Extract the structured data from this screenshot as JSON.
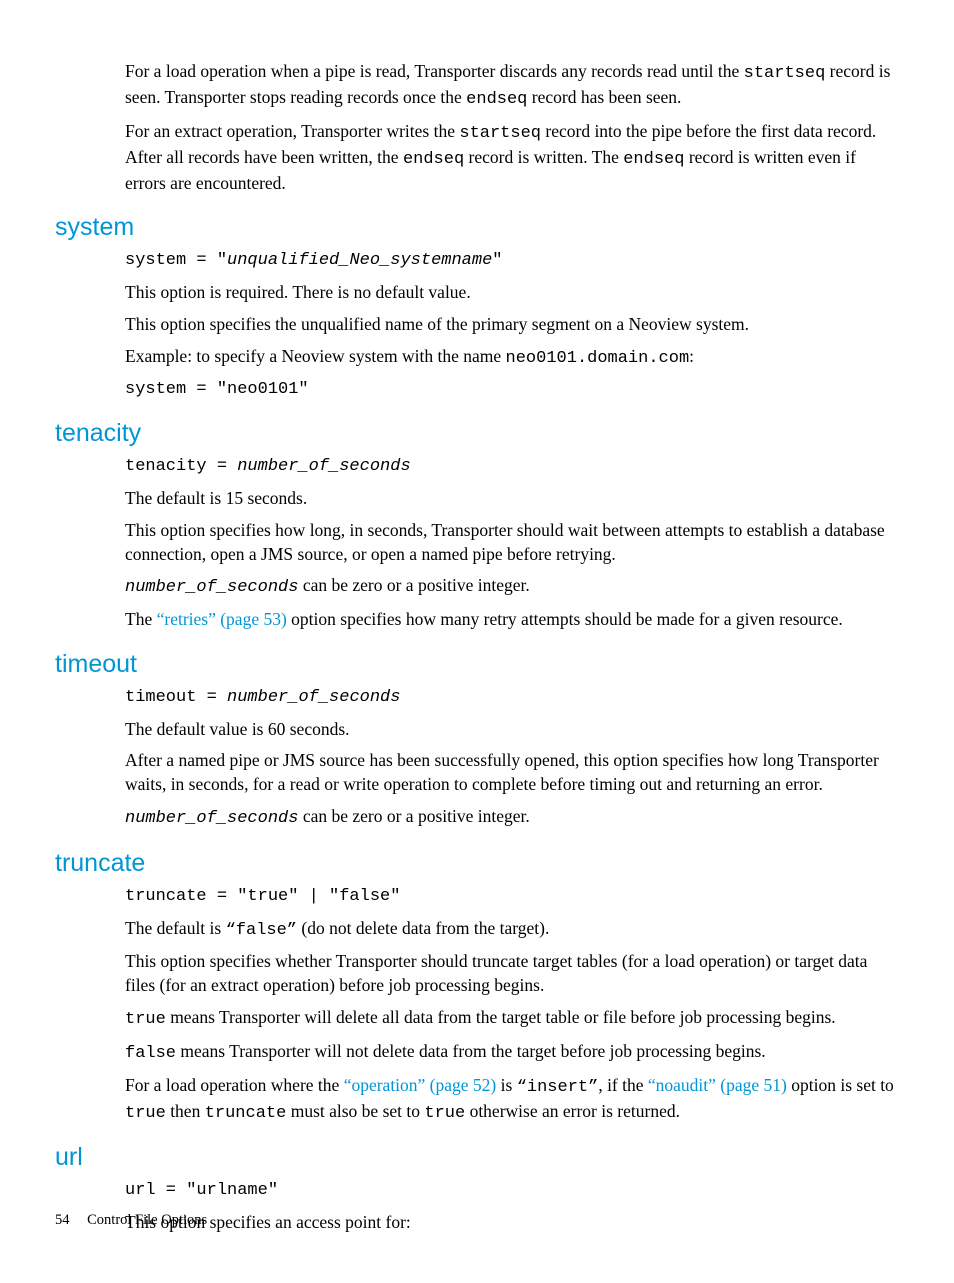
{
  "intro": {
    "p1a": "For a load operation when a pipe is read, Transporter discards any records read until the ",
    "p1b": "startseq",
    "p1c": " record is seen. Transporter stops reading records once the ",
    "p1d": "endseq",
    "p1e": " record has been seen.",
    "p2a": "For an extract operation, Transporter writes the ",
    "p2b": "startseq",
    "p2c": " record into the pipe before the first data record. After all records have been written, the ",
    "p2d": "endseq",
    "p2e": " record is written. The ",
    "p2f": "endseq",
    "p2g": " record is written even if errors are encountered."
  },
  "system": {
    "heading": "system",
    "syntax_a": "system = \"",
    "syntax_b": "unqualified_Neo_systemname",
    "syntax_c": "\"",
    "p1": "This option is required. There is no default value.",
    "p2": "This option specifies the unqualified name of the primary segment on a Neoview system.",
    "p3a": "Example: to specify a Neoview system with the name ",
    "p3b": "neo0101.domain.com",
    "p3c": ":",
    "p4": "system = \"neo0101\""
  },
  "tenacity": {
    "heading": "tenacity",
    "syntax_a": "tenacity = ",
    "syntax_b": "number_of_seconds",
    "p1": "The default is 15 seconds.",
    "p2": "This option specifies how long, in seconds, Transporter should wait between attempts to establish a database connection, open a JMS source, or open a named pipe before retrying.",
    "p3a": "number_of_seconds",
    "p3b": " can be zero or a positive integer.",
    "p4a": "The ",
    "p4link": "“retries” (page 53)",
    "p4b": " option specifies how many retry attempts should be made for a given resource."
  },
  "timeout": {
    "heading": "timeout",
    "syntax_a": "timeout = ",
    "syntax_b": "number_of_seconds",
    "p1": "The default value is 60 seconds.",
    "p2": "After a named pipe or JMS source has been successfully opened, this option specifies how long Transporter waits, in seconds, for a read or write operation to complete before timing out and returning an error.",
    "p3a": "number_of_seconds",
    "p3b": " can be zero or a positive integer."
  },
  "truncate": {
    "heading": "truncate",
    "syntax": "truncate = \"true\" | \"false\"",
    "p1a": "The default is  ",
    "p1b": "“false”",
    "p1c": " (do not delete data from the target).",
    "p2": "This option specifies whether Transporter should truncate target tables (for a load operation) or target data files (for an extract operation) before job processing begins.",
    "p3a": "true",
    "p3b": " means Transporter will delete all data from the target table or file before job processing begins.",
    "p4a": "false",
    "p4b": " means Transporter will not delete data from the target before job processing begins.",
    "p5a": "For a load operation where the ",
    "p5link1": "“operation” (page 52)",
    "p5b": " is ",
    "p5c": "“insert”",
    "p5d": ", if the ",
    "p5link2": "“noaudit” (page 51)",
    "p5e": " option is set to ",
    "p5f": "true",
    "p5g": " then ",
    "p5h": "truncate",
    "p5i": " must also be set to ",
    "p5j": "true",
    "p5k": " otherwise an error is returned."
  },
  "url": {
    "heading": "url",
    "syntax": "url = \"urlname\"",
    "p1": "This option specifies an access point for:"
  },
  "footer": {
    "page": "54",
    "title": "Control File Options"
  }
}
